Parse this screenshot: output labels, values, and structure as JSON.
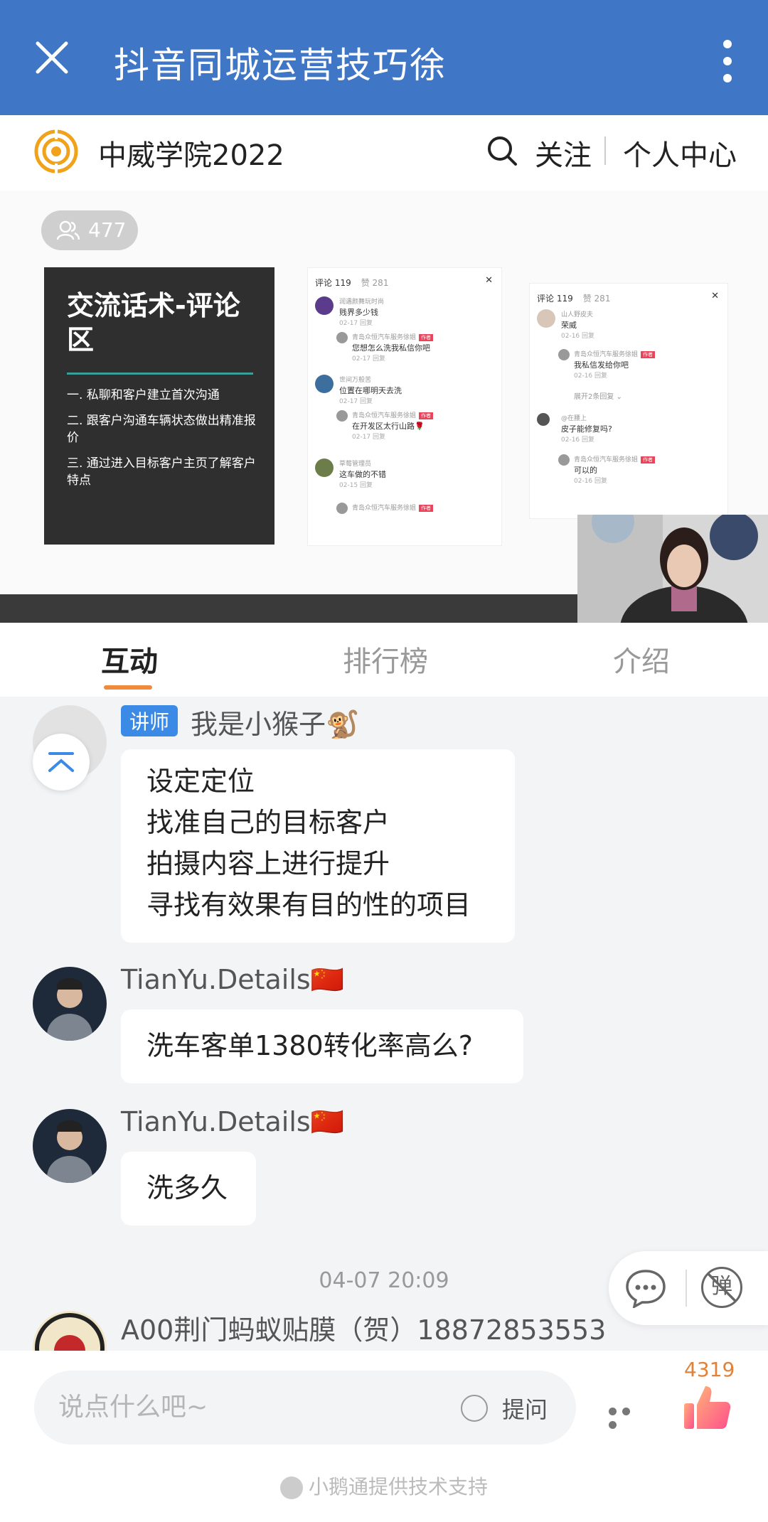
{
  "header": {
    "title": "抖音同城运营技巧徐"
  },
  "site": {
    "brand": "中威学院2022",
    "follow": "关注",
    "personal_center": "个人中心"
  },
  "video": {
    "viewer_count": "477",
    "slide": {
      "title": "交流话术-评论区",
      "items": [
        "一. 私聊和客户建立首次沟通",
        "二. 跟客户沟通车辆状态做出精准报价",
        "三. 通过进入目标客户主页了解客户特点"
      ]
    },
    "screenshot_left": {
      "comments_label": "评论 119",
      "likes_label": "赞 281",
      "rows": [
        {
          "user": "润遇颜舞玩时尚",
          "text": "贱界多少钱",
          "meta": "02-17   回复"
        },
        {
          "user": "青岛众恒汽车服务徐姐",
          "tag": "作者",
          "text": "您想怎么洗我私信你吧",
          "meta": "02-17   回复"
        },
        {
          "user": "世间万般苦",
          "text": "位置在哪明天去洗",
          "meta": "02-17   回复"
        },
        {
          "user": "青岛众恒汽车服务徐姐",
          "tag": "作者",
          "text": "在开发区太行山路🌹",
          "meta": "02-17   回复"
        },
        {
          "user": "草莓管理员",
          "text": "这车做的不错",
          "meta": "02-15   回复"
        },
        {
          "user": "青岛众恒汽车服务徐姐",
          "tag": "作者",
          "text": "",
          "meta": ""
        }
      ]
    },
    "screenshot_right": {
      "comments_label": "评论 119",
      "likes_label": "赞 281",
      "rows": [
        {
          "user": "山人野皮夫",
          "text": "荣威",
          "meta": "02-16   回复"
        },
        {
          "user": "青岛众恒汽车服务徐姐",
          "tag": "作者",
          "text": "我私信发给你吧",
          "meta": "02-16   回复"
        },
        {
          "user": "",
          "text": "展开2条回复 ⌄",
          "meta": ""
        },
        {
          "user": "@在腰上",
          "text": "皮子能修复吗?",
          "meta": "02-16   回复"
        },
        {
          "user": "青岛众恒汽车服务徐姐",
          "tag": "作者",
          "text": "可以的",
          "meta": "02-16   回复"
        }
      ]
    }
  },
  "tabs": [
    {
      "label": "互动",
      "active": true
    },
    {
      "label": "排行榜",
      "active": false
    },
    {
      "label": "介绍",
      "active": false
    }
  ],
  "messages": [
    {
      "badge": "讲师",
      "name": "我是小猴子🐒",
      "lines": [
        "设定定位",
        "找准自己的目标客户",
        "拍摄内容上进行提升",
        "寻找有效果有目的性的项目"
      ]
    },
    {
      "name": "TianYu.Details🇨🇳",
      "text": "洗车客单1380转化率高么?"
    },
    {
      "name": "TianYu.Details🇨🇳",
      "text": "洗多久"
    },
    {
      "name": "A00荆门蚂蚁贴膜（贺）18872853553",
      "text": ""
    }
  ],
  "timestamp": "04-07 20:09",
  "float_buttons": {
    "danmaku_label": "弹"
  },
  "input": {
    "placeholder": "说点什么吧~",
    "question_label": "提问",
    "like_count": "4319"
  },
  "footer": {
    "text": "小鹅通提供技术支持"
  },
  "colors": {
    "header_bg": "#3f76c6",
    "accent": "#f08a3c",
    "badge": "#3a8ae6"
  }
}
